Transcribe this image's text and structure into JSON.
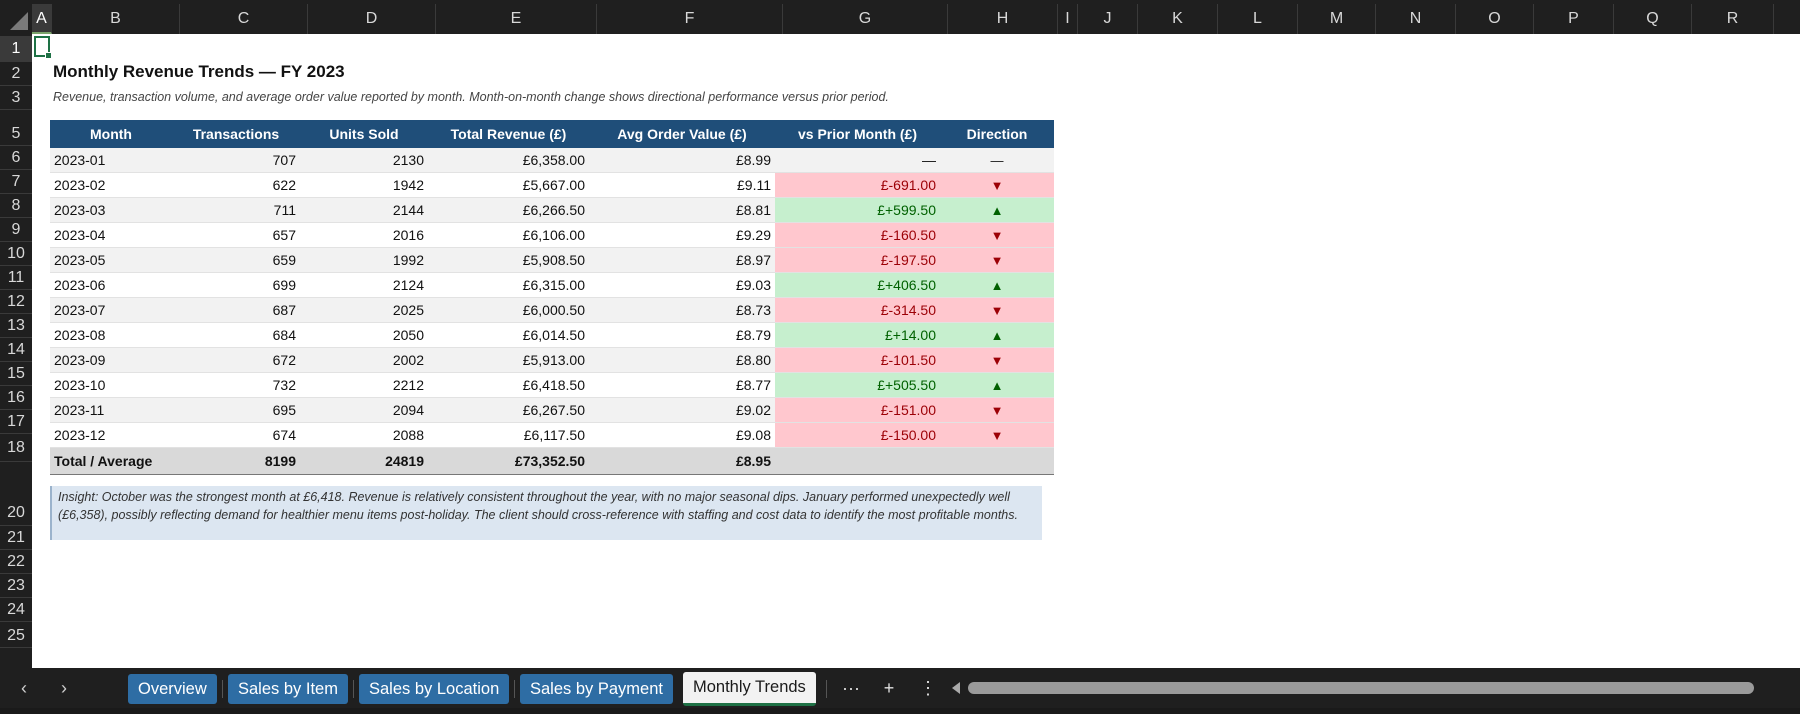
{
  "columns": [
    {
      "label": "A",
      "selected": true
    },
    {
      "label": "B"
    },
    {
      "label": "C"
    },
    {
      "label": "D"
    },
    {
      "label": "E"
    },
    {
      "label": "F"
    },
    {
      "label": "G"
    },
    {
      "label": "H"
    },
    {
      "label": "I"
    },
    {
      "label": "J"
    },
    {
      "label": "K"
    },
    {
      "label": "L"
    },
    {
      "label": "M"
    },
    {
      "label": "N"
    },
    {
      "label": "O"
    },
    {
      "label": "P"
    },
    {
      "label": "Q"
    },
    {
      "label": "R"
    }
  ],
  "rows": [
    "1",
    "2",
    "3",
    "5",
    "6",
    "7",
    "8",
    "9",
    "10",
    "11",
    "12",
    "13",
    "14",
    "15",
    "16",
    "17",
    "18",
    "20",
    "21",
    "22",
    "23",
    "24",
    "25"
  ],
  "report": {
    "title": "Monthly Revenue Trends — FY 2023",
    "subtitle": "Revenue, transaction volume, and average order value reported by month. Month-on-month change shows directional performance versus prior period.",
    "headers": [
      "Month",
      "Transactions",
      "Units Sold",
      "Total Revenue (£)",
      "Avg Order Value (£)",
      "vs Prior Month (£)",
      "Direction"
    ],
    "rows": [
      {
        "month": "2023-01",
        "transactions": "707",
        "units": "2130",
        "revenue": "£6,358.00",
        "aov": "£8.99",
        "change": "—",
        "direction": "—",
        "trend": "none"
      },
      {
        "month": "2023-02",
        "transactions": "622",
        "units": "1942",
        "revenue": "£5,667.00",
        "aov": "£9.11",
        "change": "£-691.00",
        "direction": "▼",
        "trend": "down"
      },
      {
        "month": "2023-03",
        "transactions": "711",
        "units": "2144",
        "revenue": "£6,266.50",
        "aov": "£8.81",
        "change": "£+599.50",
        "direction": "▲",
        "trend": "up"
      },
      {
        "month": "2023-04",
        "transactions": "657",
        "units": "2016",
        "revenue": "£6,106.00",
        "aov": "£9.29",
        "change": "£-160.50",
        "direction": "▼",
        "trend": "down"
      },
      {
        "month": "2023-05",
        "transactions": "659",
        "units": "1992",
        "revenue": "£5,908.50",
        "aov": "£8.97",
        "change": "£-197.50",
        "direction": "▼",
        "trend": "down"
      },
      {
        "month": "2023-06",
        "transactions": "699",
        "units": "2124",
        "revenue": "£6,315.00",
        "aov": "£9.03",
        "change": "£+406.50",
        "direction": "▲",
        "trend": "up"
      },
      {
        "month": "2023-07",
        "transactions": "687",
        "units": "2025",
        "revenue": "£6,000.50",
        "aov": "£8.73",
        "change": "£-314.50",
        "direction": "▼",
        "trend": "down"
      },
      {
        "month": "2023-08",
        "transactions": "684",
        "units": "2050",
        "revenue": "£6,014.50",
        "aov": "£8.79",
        "change": "£+14.00",
        "direction": "▲",
        "trend": "up"
      },
      {
        "month": "2023-09",
        "transactions": "672",
        "units": "2002",
        "revenue": "£5,913.00",
        "aov": "£8.80",
        "change": "£-101.50",
        "direction": "▼",
        "trend": "down"
      },
      {
        "month": "2023-10",
        "transactions": "732",
        "units": "2212",
        "revenue": "£6,418.50",
        "aov": "£8.77",
        "change": "£+505.50",
        "direction": "▲",
        "trend": "up"
      },
      {
        "month": "2023-11",
        "transactions": "695",
        "units": "2094",
        "revenue": "£6,267.50",
        "aov": "£9.02",
        "change": "£-151.00",
        "direction": "▼",
        "trend": "down"
      },
      {
        "month": "2023-12",
        "transactions": "674",
        "units": "2088",
        "revenue": "£6,117.50",
        "aov": "£9.08",
        "change": "£-150.00",
        "direction": "▼",
        "trend": "down"
      }
    ],
    "totals": {
      "label": "Total / Average",
      "transactions": "8199",
      "units": "24819",
      "revenue": "£73,352.50",
      "aov": "£8.95"
    },
    "insight": "Insight: October was the strongest month at £6,418. Revenue is relatively consistent throughout the year, with no major seasonal dips. January performed unexpectedly well (£6,358), possibly reflecting demand for healthier menu items post-holiday. The client should cross-reference with staffing and cost data to identify the most profitable months."
  },
  "colors": {
    "header_bg": "#1f4e79",
    "up_bg": "#c6efce",
    "up_fg": "#006100",
    "down_bg": "#ffc7ce",
    "down_fg": "#9c0006",
    "tab_bg": "#2e6da4",
    "active_tab_underline": "#1e7145"
  },
  "sheet_tabs": [
    {
      "label": "Overview",
      "active": false
    },
    {
      "label": "Sales by Item",
      "active": false
    },
    {
      "label": "Sales by Location",
      "active": false
    },
    {
      "label": "Sales by Payment",
      "active": false
    },
    {
      "label": "Monthly Trends",
      "active": true
    }
  ],
  "tabbar_icons": {
    "prev": "chevron-left-icon",
    "next": "chevron-right-icon",
    "more": "ellipsis-icon",
    "add": "plus-icon",
    "options": "vertical-dots-icon"
  },
  "tabbar_glyphs": {
    "prev": "‹",
    "next": "›",
    "more": "···",
    "add": "+",
    "options": "⋮"
  }
}
